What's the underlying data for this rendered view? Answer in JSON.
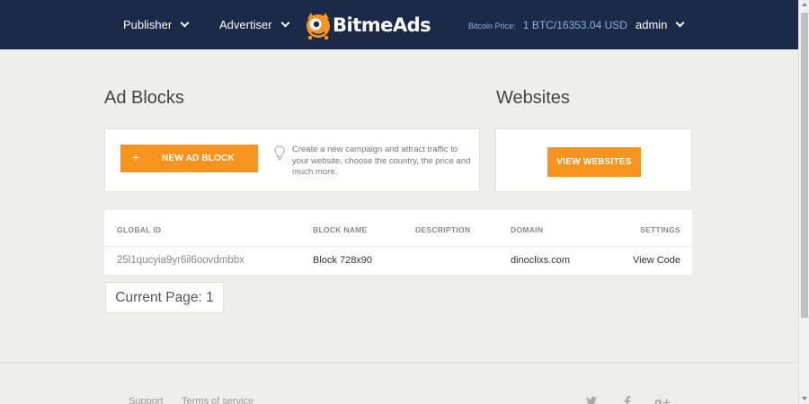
{
  "header": {
    "nav": [
      {
        "label": "Publisher"
      },
      {
        "label": "Advertiser"
      }
    ],
    "brand": "BitmeAds",
    "bitcoin_price_label": "Bitcoin Price:",
    "bitcoin_price_value": "1 BTC/16353.04 USD",
    "user": "admin"
  },
  "ad_blocks": {
    "title": "Ad Blocks",
    "new_button": "NEW AD BLOCK",
    "new_button_icon": "+",
    "hint": "Create a new campaign and attract traffic to your website, choose the country, the price and much more."
  },
  "websites": {
    "title": "Websites",
    "view_button": "VIEW WEBSITES"
  },
  "table": {
    "columns": [
      "GLOBAL ID",
      "BLOCK NAME",
      "DESCRIPTION",
      "DOMAIN",
      "SETTINGS"
    ],
    "rows": [
      {
        "global_id": "25l1qucyia9yr6il6oovdmbbx",
        "block_name": "Block 728x90",
        "description": "",
        "domain": "dinoclixs.com",
        "settings": "View Code"
      }
    ]
  },
  "pager": {
    "label": "Current Page: 1"
  },
  "footer": {
    "links": [
      "Support",
      "Terms of service"
    ],
    "social_icons": [
      "twitter-icon",
      "facebook-icon",
      "google-plus-icon"
    ]
  },
  "colors": {
    "header_bg": "#1b2a48",
    "accent": "#f7941d",
    "page_bg": "#eeeeea"
  }
}
